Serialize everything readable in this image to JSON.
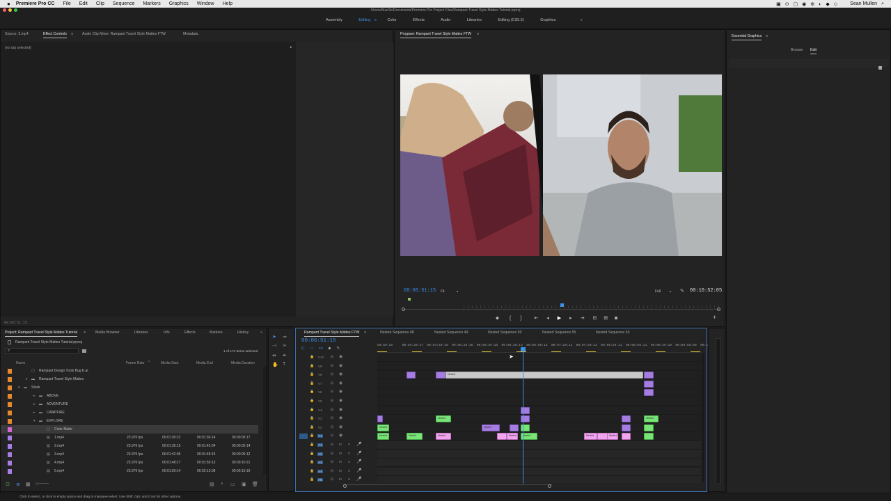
{
  "menubar": {
    "app": "Premiere Pro CC",
    "items": [
      "File",
      "Edit",
      "Clip",
      "Sequence",
      "Markers",
      "Graphics",
      "Window",
      "Help"
    ],
    "user": "Sean Mullen"
  },
  "title_path": "/Users/MacSk/Documents/Premiere Pro Project Files/Rampant Travel Style Mattes Tutorial.prproj",
  "workspaces": [
    "Assembly",
    "Editing",
    "Color",
    "Effects",
    "Audio",
    "Libraries",
    "Editing (CS5.5)",
    "Graphics"
  ],
  "workspace_more": "»",
  "source_tabs": [
    "Source: 3.mp4",
    "Effect Controls",
    "Audio Clip Mixer: Rampant Travel Style Mattes FTW",
    "Metadata"
  ],
  "no_clip": "(no clip selected)",
  "ec_timecode": "00:06:51:15",
  "program": {
    "title": "Program: Rampant Travel Style Mattes FTW",
    "timecode": "00:06:51:15",
    "fit": "Fit",
    "quality": "Full",
    "duration": "00:10:52:05"
  },
  "essential": {
    "title": "Essential Graphics",
    "tabs": [
      "Browse",
      "Edit"
    ]
  },
  "project": {
    "tabs": [
      "Project: Rampant Travel Style Mattes Tutorial",
      "Media Browser",
      "Libraries",
      "Info",
      "Effects",
      "Markers",
      "History"
    ],
    "file": "Rampant Travel Style Mattes Tutorial.prproj",
    "selected": "1 of 174 items selected",
    "headers": [
      "Name",
      "Frame Rate",
      "Media Start",
      "Media End",
      "Media Duration"
    ],
    "rows": [
      {
        "name": "Rampant Design Tools Bug K.ai",
        "fps": "",
        "start": "",
        "end": "",
        "dur": "",
        "color": "#e58a2c",
        "indent": 2
      },
      {
        "name": "Rampant Travel Style Mattes",
        "fps": "",
        "start": "",
        "end": "",
        "dur": "",
        "color": "#e58a2c",
        "indent": 2
      },
      {
        "name": "Stock",
        "fps": "",
        "start": "",
        "end": "",
        "dur": "",
        "color": "#e58a2c",
        "indent": 1
      },
      {
        "name": "ABOVE",
        "fps": "",
        "start": "",
        "end": "",
        "dur": "",
        "color": "#e58a2c",
        "indent": 3
      },
      {
        "name": "ADVENTURE",
        "fps": "",
        "start": "",
        "end": "",
        "dur": "",
        "color": "#e58a2c",
        "indent": 3
      },
      {
        "name": "CAMPFIRE",
        "fps": "",
        "start": "",
        "end": "",
        "dur": "",
        "color": "#e58a2c",
        "indent": 3
      },
      {
        "name": "EXPLORE",
        "fps": "",
        "start": "",
        "end": "",
        "dur": "",
        "color": "#e58a2c",
        "indent": 3
      },
      {
        "name": "Color Matte",
        "fps": "",
        "start": "",
        "end": "",
        "dur": "",
        "color": "#d866d0",
        "indent": 4
      },
      {
        "name": "1.mp4",
        "fps": "23.976 fps",
        "start": "00:01:30:22",
        "end": "00:01:36:14",
        "dur": "00:00:05:17",
        "color": "#a77ee5",
        "indent": 4
      },
      {
        "name": "2.mp4",
        "fps": "23.976 fps",
        "start": "00:01:36:15",
        "end": "00:01:42:04",
        "dur": "00:00:05:14",
        "color": "#a77ee5",
        "indent": 4
      },
      {
        "name": "3.mp4",
        "fps": "23.976 fps",
        "start": "00:01:42:05",
        "end": "00:01:48:16",
        "dur": "00:00:06:12",
        "color": "#a77ee5",
        "indent": 4
      },
      {
        "name": "4.mp4",
        "fps": "23.976 fps",
        "start": "00:01:48:17",
        "end": "00:01:59:13",
        "dur": "00:00:10:21",
        "color": "#a77ee5",
        "indent": 4
      },
      {
        "name": "5.mp4",
        "fps": "23.976 fps",
        "start": "00:01:59:14",
        "end": "00:02:15:08",
        "dur": "00:00:15:19",
        "color": "#a77ee5",
        "indent": 4
      }
    ]
  },
  "timeline": {
    "tabs": [
      "Rampant Travel Style Mattes FTW",
      "Nested Sequence 48",
      "Nested Sequence 49",
      "Nested Sequence 50",
      "Nested Sequence 55",
      "Nested Sequence 56"
    ],
    "timecode": "00:06:51:15",
    "ruler": [
      "03:59:18",
      "00:04:29:17",
      "00:04:59:16",
      "00:05:29:16",
      "00:05:59:15",
      "00:06:29:14",
      "00:06:59:13",
      "00:07:29:13",
      "00:07:59:12",
      "00:08:29:11",
      "00:08:59:11",
      "00:09:29:10",
      "00:09:59:09",
      "00:1"
    ],
    "video_tracks": [
      "V10",
      "V9",
      "V8",
      "V7",
      "V6",
      "V5",
      "V4",
      "V3",
      "V2",
      "V1"
    ],
    "audio_tracks": [
      "A1",
      "A2",
      "A3",
      "A4",
      "A5"
    ],
    "clip_label": "Nested"
  },
  "status": "Click to select, or click in empty space and drag to marquee select. Use Shift, Opt, and Cmd for other options."
}
